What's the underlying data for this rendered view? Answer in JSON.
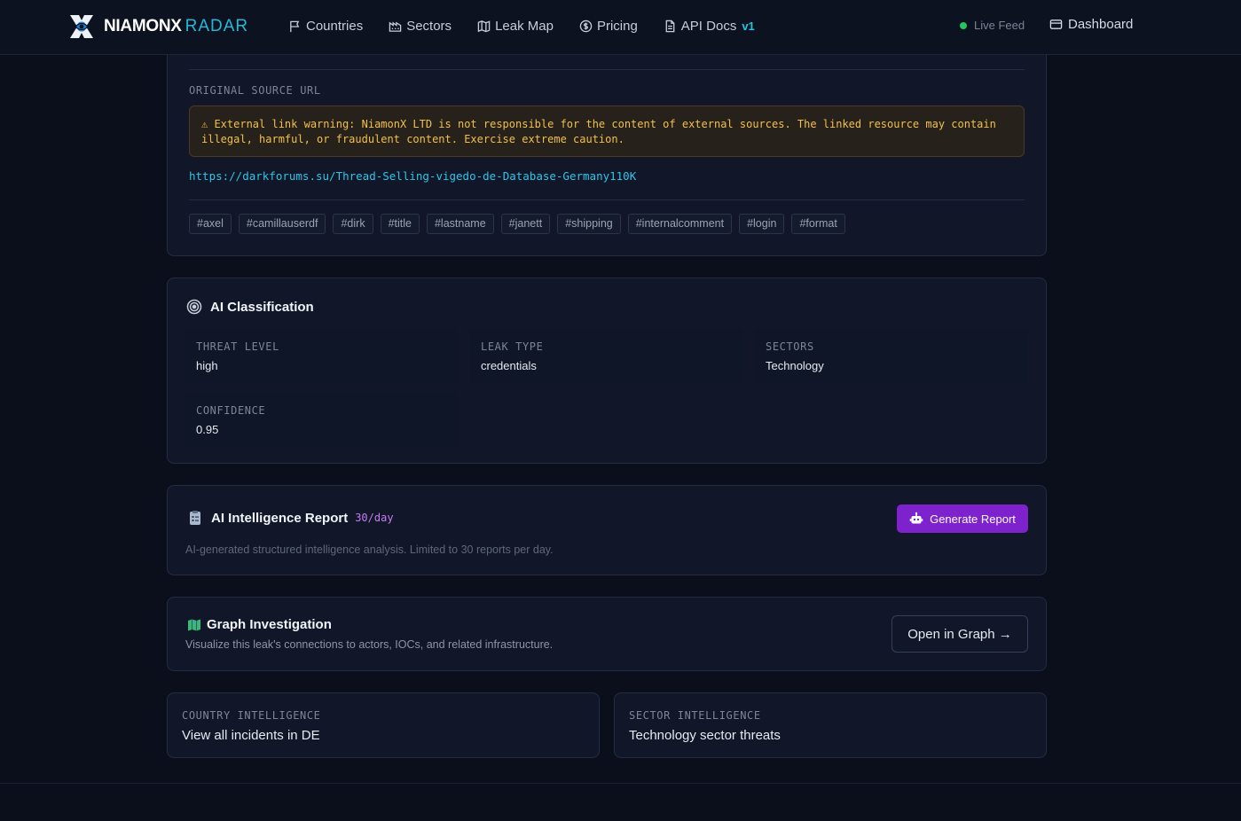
{
  "brand": {
    "name_primary": "NIAMONX",
    "name_secondary": "RADAR"
  },
  "nav": {
    "items": [
      {
        "label": "Countries",
        "icon": "flag-icon"
      },
      {
        "label": "Sectors",
        "icon": "factory-icon"
      },
      {
        "label": "Leak Map",
        "icon": "map-icon"
      },
      {
        "label": "Pricing",
        "icon": "dollar-circle-icon"
      },
      {
        "label": "API Docs",
        "icon": "document-icon",
        "badge": "v1"
      }
    ],
    "live_feed": "Live Feed",
    "dashboard": "Dashboard"
  },
  "source": {
    "label": "ORIGINAL SOURCE URL",
    "warning": "⚠ External link warning: NiamonX LTD is not responsible for the content of external sources. The linked resource may contain illegal, harmful, or fraudulent content. Exercise extreme caution.",
    "url": "https://darkforums.su/Thread-Selling-vigedo-de-Database-Germany110K"
  },
  "tags": [
    "#axel",
    "#camillauserdf",
    "#dirk",
    "#title",
    "#lastname",
    "#janett",
    "#shipping",
    "#internalcomment",
    "#login",
    "#format"
  ],
  "ai_classification": {
    "title": "AI Classification",
    "threat_level": {
      "label": "THREAT LEVEL",
      "value": "high"
    },
    "leak_type": {
      "label": "LEAK TYPE",
      "value": "credentials"
    },
    "sectors": {
      "label": "SECTORS",
      "value": "Technology"
    },
    "confidence": {
      "label": "CONFIDENCE",
      "value": "0.95"
    }
  },
  "report": {
    "title": "AI Intelligence Report",
    "rate": "30/day",
    "button": "Generate Report",
    "description": "AI-generated structured intelligence analysis. Limited to 30 reports per day."
  },
  "graph": {
    "title": "Graph Investigation",
    "description": "Visualize this leak's connections to actors, IOCs, and related infrastructure.",
    "button": "Open in Graph →"
  },
  "country_intel": {
    "label": "COUNTRY INTELLIGENCE",
    "value": "View all incidents in DE"
  },
  "sector_intel": {
    "label": "SECTOR INTELLIGENCE",
    "value": "Technology sector threats"
  },
  "colors": {
    "accent_cyan": "#22b8d8",
    "accent_purple": "#7e22ce",
    "warning_text": "#f2c04a",
    "live_green": "#22c55e",
    "background": "#0b0f1c"
  }
}
